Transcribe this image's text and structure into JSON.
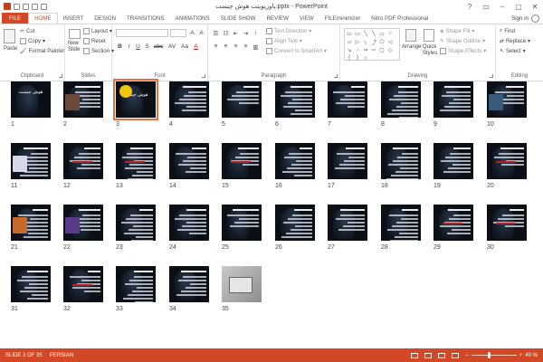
{
  "window": {
    "title": "پاورپوینت هوش چیست.pptx - PowerPoint",
    "controls": [
      "?",
      "▭",
      "–",
      "▢",
      "✕"
    ]
  },
  "ribbon_tabs": [
    {
      "label": "FILE",
      "kind": "file"
    },
    {
      "label": "HOME",
      "kind": "active"
    },
    {
      "label": "INSERT"
    },
    {
      "label": "DESIGN"
    },
    {
      "label": "TRANSITIONS"
    },
    {
      "label": "ANIMATIONS"
    },
    {
      "label": "SLIDE SHOW"
    },
    {
      "label": "REVIEW"
    },
    {
      "label": "VIEW"
    },
    {
      "label": "FILEminimizer"
    },
    {
      "label": "Nitro PDF Professional"
    }
  ],
  "account": {
    "label": "Sign in"
  },
  "clipboard": {
    "paste": "Paste",
    "cut": "Cut",
    "copy": "Copy",
    "format_painter": "Format Painter",
    "label": "Clipboard"
  },
  "slides_group": {
    "new_slide": "New\nSlide",
    "layout": "Layout",
    "reset": "Reset",
    "section": "Section",
    "label": "Slides"
  },
  "font_group": {
    "buttons": [
      "B",
      "I",
      "U",
      "S",
      "abc",
      "AV",
      "Aa",
      "A"
    ],
    "label": "Font"
  },
  "paragraph_group": {
    "text_direction": "Text Direction",
    "align_text": "Align Text",
    "convert": "Convert to SmartArt",
    "label": "Paragraph"
  },
  "drawing_group": {
    "shapes": [
      "▭",
      "▭",
      "╲",
      "╲",
      "▭",
      "○",
      "▱",
      "▷",
      "╮",
      "⤴",
      "⬠",
      "◁",
      "↘",
      "↓",
      "⇒",
      "⇨",
      "▢",
      "◇",
      "{",
      "}",
      "☆",
      "⌒",
      "⤵",
      "▭"
    ],
    "arrange": "Arrange",
    "quick_styles": "Quick\nStyles",
    "shape_fill": "Shape Fill",
    "shape_outline": "Shape Outline",
    "shape_effects": "Shape Effects",
    "label": "Drawing"
  },
  "editing_group": {
    "find": "Find",
    "replace": "Replace",
    "select": "Select",
    "label": "Editing"
  },
  "slides": [
    {
      "num": "1",
      "title": "هوش چیست"
    },
    {
      "num": "2"
    },
    {
      "num": "3",
      "title": "هوش چیست"
    },
    {
      "num": "4"
    },
    {
      "num": "5"
    },
    {
      "num": "6"
    },
    {
      "num": "7"
    },
    {
      "num": "8"
    },
    {
      "num": "9"
    },
    {
      "num": "10"
    },
    {
      "num": "11"
    },
    {
      "num": "12"
    },
    {
      "num": "13"
    },
    {
      "num": "14"
    },
    {
      "num": "15"
    },
    {
      "num": "16"
    },
    {
      "num": "17"
    },
    {
      "num": "18"
    },
    {
      "num": "19"
    },
    {
      "num": "20"
    },
    {
      "num": "21"
    },
    {
      "num": "22"
    },
    {
      "num": "23"
    },
    {
      "num": "24"
    },
    {
      "num": "25"
    },
    {
      "num": "26"
    },
    {
      "num": "27"
    },
    {
      "num": "28"
    },
    {
      "num": "29"
    },
    {
      "num": "30"
    },
    {
      "num": "31"
    },
    {
      "num": "32"
    },
    {
      "num": "33"
    },
    {
      "num": "34"
    },
    {
      "num": "35"
    }
  ],
  "selected_slide": 3,
  "status": {
    "slide_info": "SLIDE 3 OF 35",
    "language": "PERSIAN",
    "zoom": "40 %",
    "zoom_minus": "−",
    "zoom_plus": "+",
    "zoom_level": 0.4
  },
  "colors": {
    "accent": "#d24726",
    "selected_outline": "#e4713d",
    "slide_bg": "#0b0f16"
  }
}
